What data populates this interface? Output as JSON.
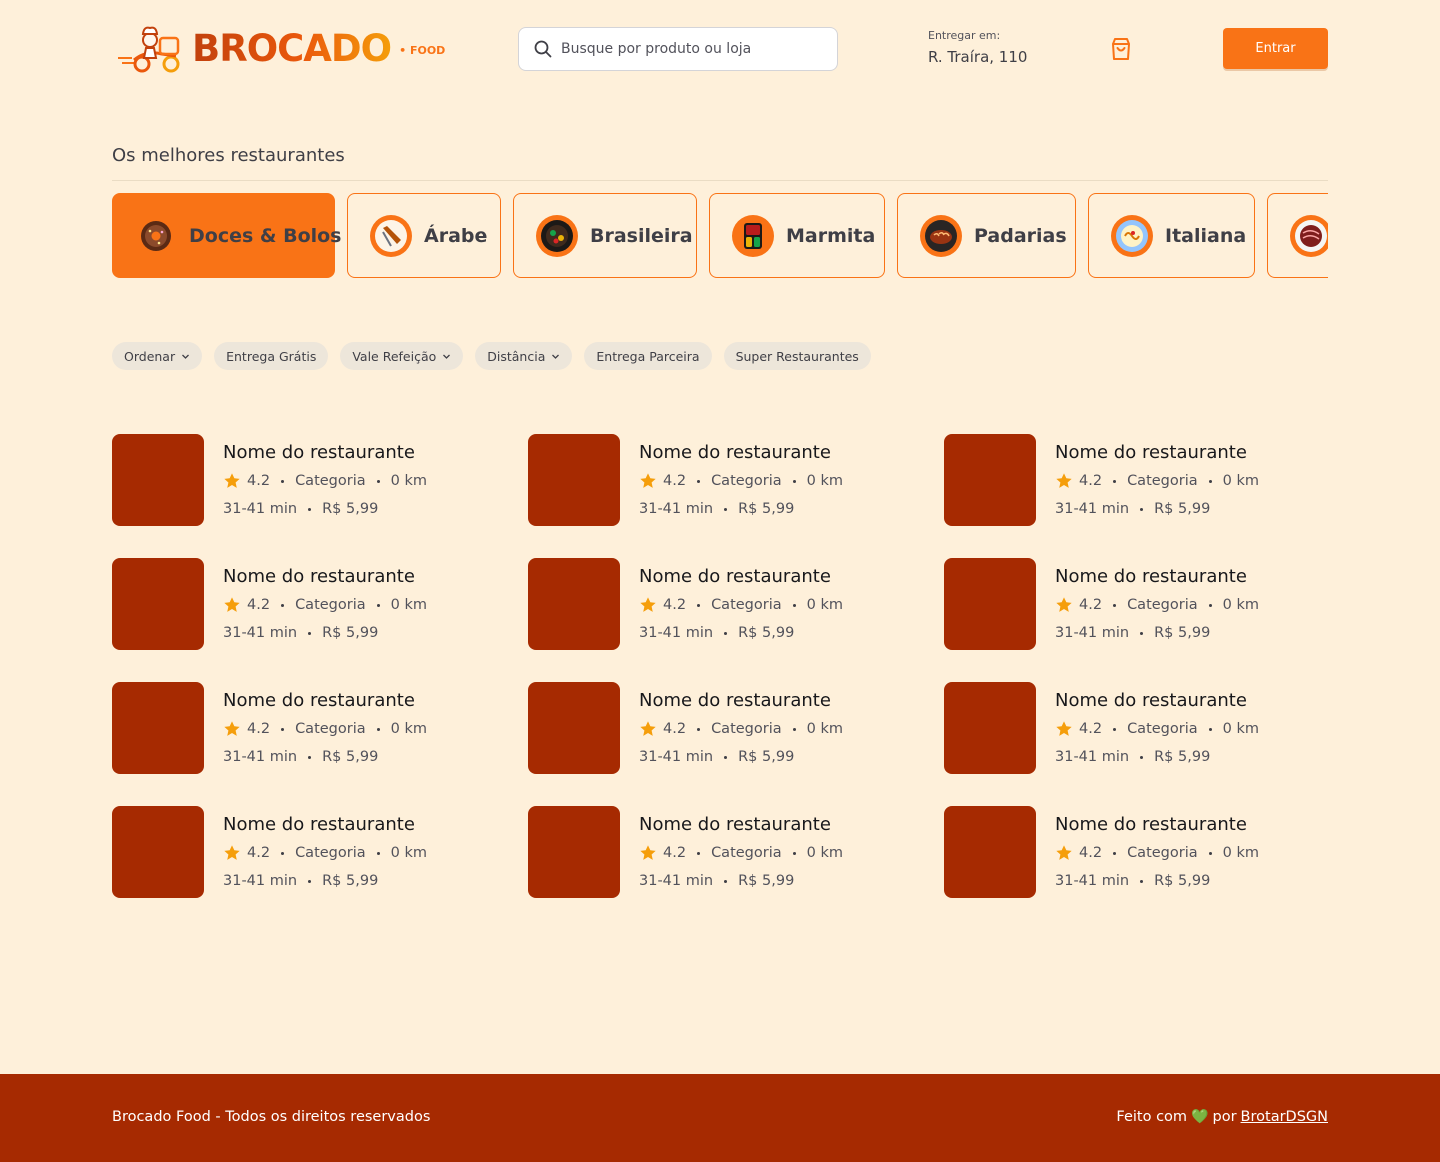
{
  "header": {
    "logo_text": "BROCADO",
    "logo_sub": "• FOOD",
    "search_placeholder": "Busque por produto ou loja",
    "deliver_label": "Entregar em:",
    "deliver_address": "R. Traíra, 110",
    "login_label": "Entrar",
    "icons": {
      "search": "search-icon",
      "cart": "shopping-bag-icon"
    }
  },
  "section": {
    "title": "Os melhores restaurantes"
  },
  "categories": [
    {
      "label": "Doces & Bolos",
      "active": true,
      "icon": "donut-icon"
    },
    {
      "label": "Árabe",
      "active": false,
      "icon": "kebab-icon"
    },
    {
      "label": "Brasileira",
      "active": false,
      "icon": "feijoada-icon"
    },
    {
      "label": "Marmita",
      "active": false,
      "icon": "lunchbox-icon"
    },
    {
      "label": "Padarias",
      "active": false,
      "icon": "bread-icon"
    },
    {
      "label": "Italiana",
      "active": false,
      "icon": "pasta-icon"
    },
    {
      "label": "",
      "active": false,
      "icon": "meat-icon"
    }
  ],
  "filters": [
    {
      "label": "Ordenar",
      "dropdown": true
    },
    {
      "label": "Entrega Grátis",
      "dropdown": false
    },
    {
      "label": "Vale Refeição",
      "dropdown": true
    },
    {
      "label": "Distância",
      "dropdown": true
    },
    {
      "label": "Entrega Parceira",
      "dropdown": false
    },
    {
      "label": "Super Restaurantes",
      "dropdown": false
    }
  ],
  "restaurants": [
    {
      "name": "Nome do restaurante",
      "rating": "4.2",
      "category": "Categoria",
      "distance": "0 km",
      "time": "31-41 min",
      "fee": "R$ 5,99"
    },
    {
      "name": "Nome do restaurante",
      "rating": "4.2",
      "category": "Categoria",
      "distance": "0 km",
      "time": "31-41 min",
      "fee": "R$ 5,99"
    },
    {
      "name": "Nome do restaurante",
      "rating": "4.2",
      "category": "Categoria",
      "distance": "0 km",
      "time": "31-41 min",
      "fee": "R$ 5,99"
    },
    {
      "name": "Nome do restaurante",
      "rating": "4.2",
      "category": "Categoria",
      "distance": "0 km",
      "time": "31-41 min",
      "fee": "R$ 5,99"
    },
    {
      "name": "Nome do restaurante",
      "rating": "4.2",
      "category": "Categoria",
      "distance": "0 km",
      "time": "31-41 min",
      "fee": "R$ 5,99"
    },
    {
      "name": "Nome do restaurante",
      "rating": "4.2",
      "category": "Categoria",
      "distance": "0 km",
      "time": "31-41 min",
      "fee": "R$ 5,99"
    },
    {
      "name": "Nome do restaurante",
      "rating": "4.2",
      "category": "Categoria",
      "distance": "0 km",
      "time": "31-41 min",
      "fee": "R$ 5,99"
    },
    {
      "name": "Nome do restaurante",
      "rating": "4.2",
      "category": "Categoria",
      "distance": "0 km",
      "time": "31-41 min",
      "fee": "R$ 5,99"
    },
    {
      "name": "Nome do restaurante",
      "rating": "4.2",
      "category": "Categoria",
      "distance": "0 km",
      "time": "31-41 min",
      "fee": "R$ 5,99"
    },
    {
      "name": "Nome do restaurante",
      "rating": "4.2",
      "category": "Categoria",
      "distance": "0 km",
      "time": "31-41 min",
      "fee": "R$ 5,99"
    },
    {
      "name": "Nome do restaurante",
      "rating": "4.2",
      "category": "Categoria",
      "distance": "0 km",
      "time": "31-41 min",
      "fee": "R$ 5,99"
    },
    {
      "name": "Nome do restaurante",
      "rating": "4.2",
      "category": "Categoria",
      "distance": "0 km",
      "time": "31-41 min",
      "fee": "R$ 5,99"
    }
  ],
  "footer": {
    "copyright": "Brocado Food - Todos os direitos reservados",
    "made_with": "Feito com",
    "heart": "💚",
    "by": "por",
    "author": "BrotarDSGN"
  },
  "colors": {
    "background": "#FEF0DA",
    "accent": "#F97316",
    "brand_dark": "#A62A01",
    "star": "#F59E0B"
  }
}
